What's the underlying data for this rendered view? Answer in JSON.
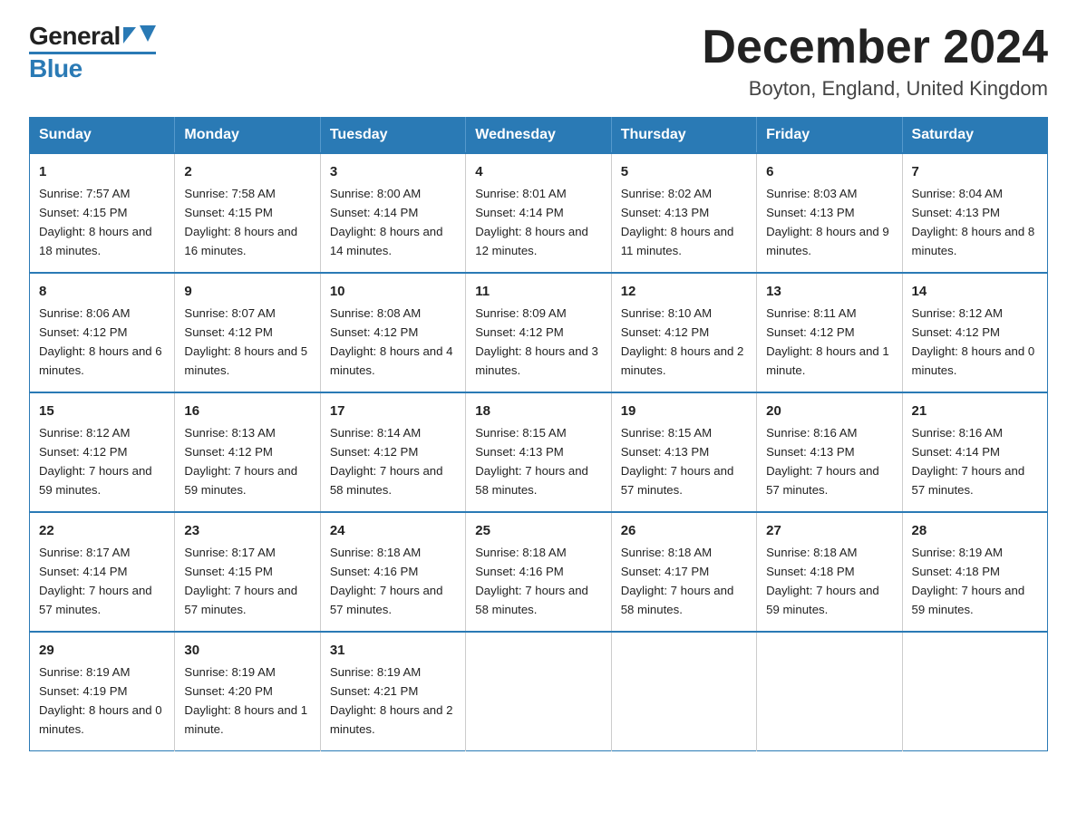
{
  "header": {
    "title": "December 2024",
    "subtitle": "Boyton, England, United Kingdom",
    "logo_general": "General",
    "logo_blue": "Blue"
  },
  "calendar": {
    "days": [
      "Sunday",
      "Monday",
      "Tuesday",
      "Wednesday",
      "Thursday",
      "Friday",
      "Saturday"
    ],
    "weeks": [
      [
        {
          "day": 1,
          "sunrise": "7:57 AM",
          "sunset": "4:15 PM",
          "daylight": "8 hours and 18 minutes."
        },
        {
          "day": 2,
          "sunrise": "7:58 AM",
          "sunset": "4:15 PM",
          "daylight": "8 hours and 16 minutes."
        },
        {
          "day": 3,
          "sunrise": "8:00 AM",
          "sunset": "4:14 PM",
          "daylight": "8 hours and 14 minutes."
        },
        {
          "day": 4,
          "sunrise": "8:01 AM",
          "sunset": "4:14 PM",
          "daylight": "8 hours and 12 minutes."
        },
        {
          "day": 5,
          "sunrise": "8:02 AM",
          "sunset": "4:13 PM",
          "daylight": "8 hours and 11 minutes."
        },
        {
          "day": 6,
          "sunrise": "8:03 AM",
          "sunset": "4:13 PM",
          "daylight": "8 hours and 9 minutes."
        },
        {
          "day": 7,
          "sunrise": "8:04 AM",
          "sunset": "4:13 PM",
          "daylight": "8 hours and 8 minutes."
        }
      ],
      [
        {
          "day": 8,
          "sunrise": "8:06 AM",
          "sunset": "4:12 PM",
          "daylight": "8 hours and 6 minutes."
        },
        {
          "day": 9,
          "sunrise": "8:07 AM",
          "sunset": "4:12 PM",
          "daylight": "8 hours and 5 minutes."
        },
        {
          "day": 10,
          "sunrise": "8:08 AM",
          "sunset": "4:12 PM",
          "daylight": "8 hours and 4 minutes."
        },
        {
          "day": 11,
          "sunrise": "8:09 AM",
          "sunset": "4:12 PM",
          "daylight": "8 hours and 3 minutes."
        },
        {
          "day": 12,
          "sunrise": "8:10 AM",
          "sunset": "4:12 PM",
          "daylight": "8 hours and 2 minutes."
        },
        {
          "day": 13,
          "sunrise": "8:11 AM",
          "sunset": "4:12 PM",
          "daylight": "8 hours and 1 minute."
        },
        {
          "day": 14,
          "sunrise": "8:12 AM",
          "sunset": "4:12 PM",
          "daylight": "8 hours and 0 minutes."
        }
      ],
      [
        {
          "day": 15,
          "sunrise": "8:12 AM",
          "sunset": "4:12 PM",
          "daylight": "7 hours and 59 minutes."
        },
        {
          "day": 16,
          "sunrise": "8:13 AM",
          "sunset": "4:12 PM",
          "daylight": "7 hours and 59 minutes."
        },
        {
          "day": 17,
          "sunrise": "8:14 AM",
          "sunset": "4:12 PM",
          "daylight": "7 hours and 58 minutes."
        },
        {
          "day": 18,
          "sunrise": "8:15 AM",
          "sunset": "4:13 PM",
          "daylight": "7 hours and 58 minutes."
        },
        {
          "day": 19,
          "sunrise": "8:15 AM",
          "sunset": "4:13 PM",
          "daylight": "7 hours and 57 minutes."
        },
        {
          "day": 20,
          "sunrise": "8:16 AM",
          "sunset": "4:13 PM",
          "daylight": "7 hours and 57 minutes."
        },
        {
          "day": 21,
          "sunrise": "8:16 AM",
          "sunset": "4:14 PM",
          "daylight": "7 hours and 57 minutes."
        }
      ],
      [
        {
          "day": 22,
          "sunrise": "8:17 AM",
          "sunset": "4:14 PM",
          "daylight": "7 hours and 57 minutes."
        },
        {
          "day": 23,
          "sunrise": "8:17 AM",
          "sunset": "4:15 PM",
          "daylight": "7 hours and 57 minutes."
        },
        {
          "day": 24,
          "sunrise": "8:18 AM",
          "sunset": "4:16 PM",
          "daylight": "7 hours and 57 minutes."
        },
        {
          "day": 25,
          "sunrise": "8:18 AM",
          "sunset": "4:16 PM",
          "daylight": "7 hours and 58 minutes."
        },
        {
          "day": 26,
          "sunrise": "8:18 AM",
          "sunset": "4:17 PM",
          "daylight": "7 hours and 58 minutes."
        },
        {
          "day": 27,
          "sunrise": "8:18 AM",
          "sunset": "4:18 PM",
          "daylight": "7 hours and 59 minutes."
        },
        {
          "day": 28,
          "sunrise": "8:19 AM",
          "sunset": "4:18 PM",
          "daylight": "7 hours and 59 minutes."
        }
      ],
      [
        {
          "day": 29,
          "sunrise": "8:19 AM",
          "sunset": "4:19 PM",
          "daylight": "8 hours and 0 minutes."
        },
        {
          "day": 30,
          "sunrise": "8:19 AM",
          "sunset": "4:20 PM",
          "daylight": "8 hours and 1 minute."
        },
        {
          "day": 31,
          "sunrise": "8:19 AM",
          "sunset": "4:21 PM",
          "daylight": "8 hours and 2 minutes."
        },
        null,
        null,
        null,
        null
      ]
    ]
  }
}
